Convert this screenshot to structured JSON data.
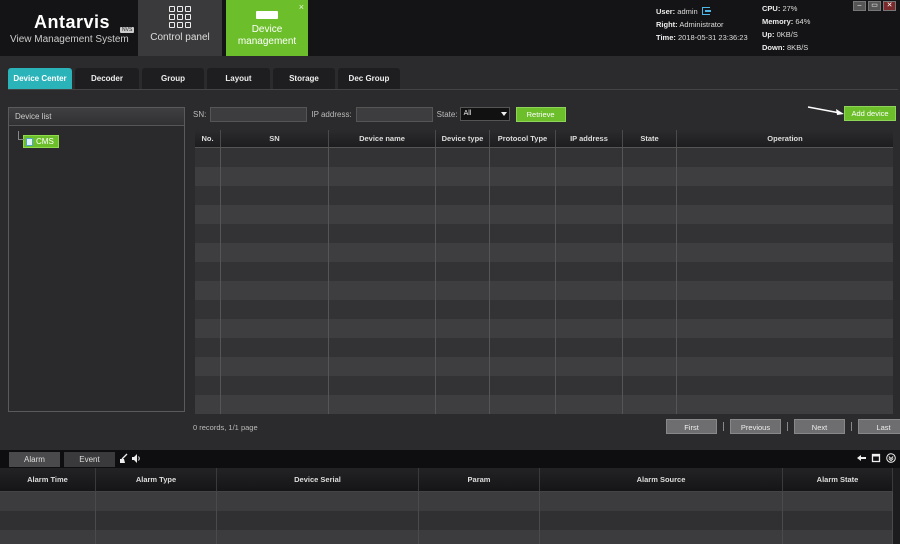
{
  "app": {
    "title": "Antarvis",
    "badge": "NVS",
    "subtitle": "View Management System"
  },
  "nav": {
    "control_panel": "Control panel",
    "device_management_line1": "Device",
    "device_management_line2": "management",
    "close_glyph": "×"
  },
  "sysinfo": {
    "user_label": "User:",
    "user_value": "admin",
    "right_label": "Right:",
    "right_value": "Administrator",
    "time_label": "Time:",
    "time_value": "2018-05-31 23:36:23",
    "cpu_label": "CPU:",
    "cpu_value": "27%",
    "memory_label": "Memory:",
    "memory_value": "64%",
    "up_label": "Up:",
    "up_value": "0KB/S",
    "down_label": "Down:",
    "down_value": "8KB/S"
  },
  "window_controls": {
    "minimize": "–",
    "maximize": "▭",
    "close": "✕"
  },
  "tabs": [
    {
      "label": "Device Center",
      "active": true
    },
    {
      "label": "Decoder",
      "active": false
    },
    {
      "label": "Group",
      "active": false
    },
    {
      "label": "Layout",
      "active": false
    },
    {
      "label": "Storage",
      "active": false
    },
    {
      "label": "Dec Group",
      "active": false
    }
  ],
  "device_list": {
    "title": "Device list",
    "root_node": "CMS"
  },
  "search": {
    "sn_label": "SN:",
    "sn_value": "",
    "ip_label": "IP address:",
    "ip_value": "",
    "state_label": "State:",
    "state_value": "All",
    "retrieve_label": "Retrieve",
    "add_device_label": "Add device"
  },
  "device_table": {
    "columns": [
      "No.",
      "SN",
      "Device name",
      "Device type",
      "Protocol Type",
      "IP address",
      "State",
      "Operation"
    ],
    "rows": [],
    "empty_row_count": 14
  },
  "pagination": {
    "records_text": "0  records,   1/1  page",
    "first": "First",
    "previous": "Previous",
    "next": "Next",
    "last": "Last"
  },
  "alarm_panel": {
    "tabs": [
      {
        "label": "Alarm",
        "active": true
      },
      {
        "label": "Event",
        "active": false
      }
    ],
    "tool_icons": [
      "broom-icon",
      "speaker-icon"
    ],
    "columns": [
      "Alarm Time",
      "Alarm Type",
      "Device Serial",
      "Param",
      "Alarm Source",
      "Alarm State"
    ],
    "rows": [],
    "empty_row_count": 3
  },
  "colors": {
    "accent_green": "#6cbf2b",
    "accent_teal": "#2ab3b8",
    "background": "#2b2b2d"
  }
}
